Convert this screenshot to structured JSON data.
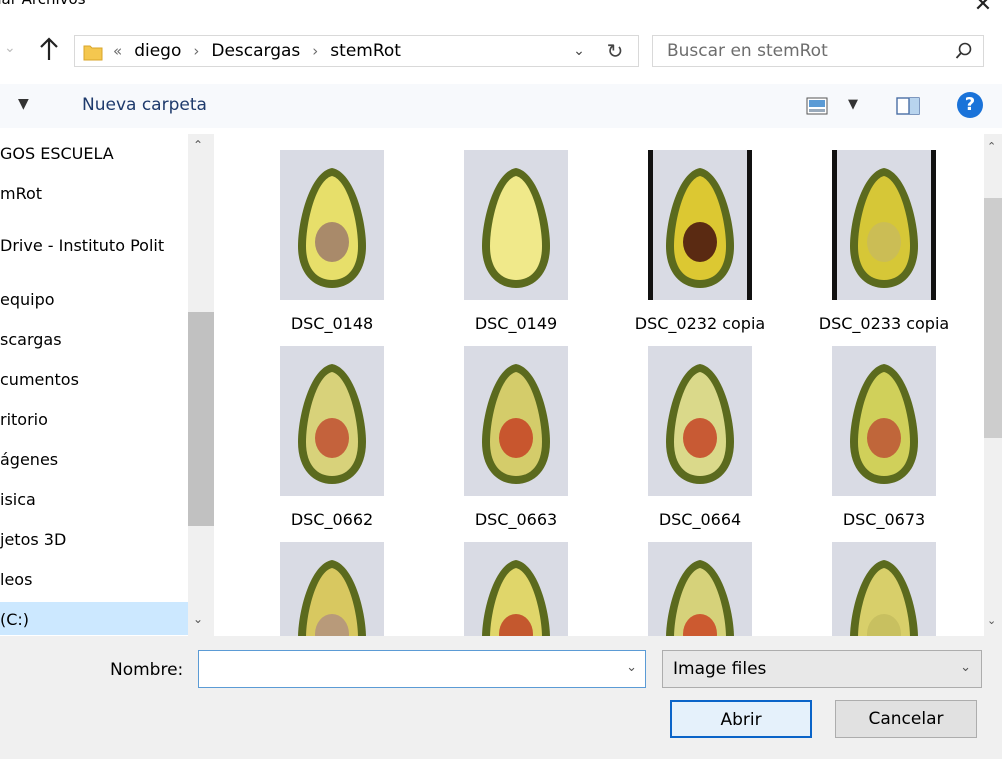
{
  "window": {
    "title": "nar Archivos"
  },
  "nav": {
    "crumb_prefix": "«",
    "crumbs": [
      "diego",
      "Descargas",
      "stemRot"
    ],
    "crumb_sep": "›"
  },
  "search": {
    "placeholder": "Buscar en stemRot"
  },
  "toolbar": {
    "new_folder": "Nueva carpeta",
    "help": "?"
  },
  "sidebar": {
    "items": [
      "GOS ESCUELA",
      "mRot",
      "Drive - Instituto Polit",
      "equipo",
      "scargas",
      "cumentos",
      "ritorio",
      "ágenes",
      "isica",
      "jetos 3D",
      "leos",
      "(C:)"
    ],
    "selected_index": 11
  },
  "files": [
    {
      "name": "DSC_0148"
    },
    {
      "name": "DSC_0149"
    },
    {
      "name": "DSC_0232 copia"
    },
    {
      "name": "DSC_0233 copia"
    },
    {
      "name": "DSC_0662"
    },
    {
      "name": "DSC_0663"
    },
    {
      "name": "DSC_0664"
    },
    {
      "name": "DSC_0673"
    },
    {
      "name": ""
    },
    {
      "name": ""
    },
    {
      "name": ""
    },
    {
      "name": ""
    }
  ],
  "footer": {
    "name_label": "Nombre:",
    "name_value": "",
    "type_value": "Image files",
    "open_label": "Abrir",
    "cancel_label": "Cancelar"
  },
  "colors": {
    "accent": "#0a64c8",
    "selection": "#cce8ff",
    "toolbar_bg": "#f7f9fc",
    "footer_bg": "#f0f0f0"
  }
}
